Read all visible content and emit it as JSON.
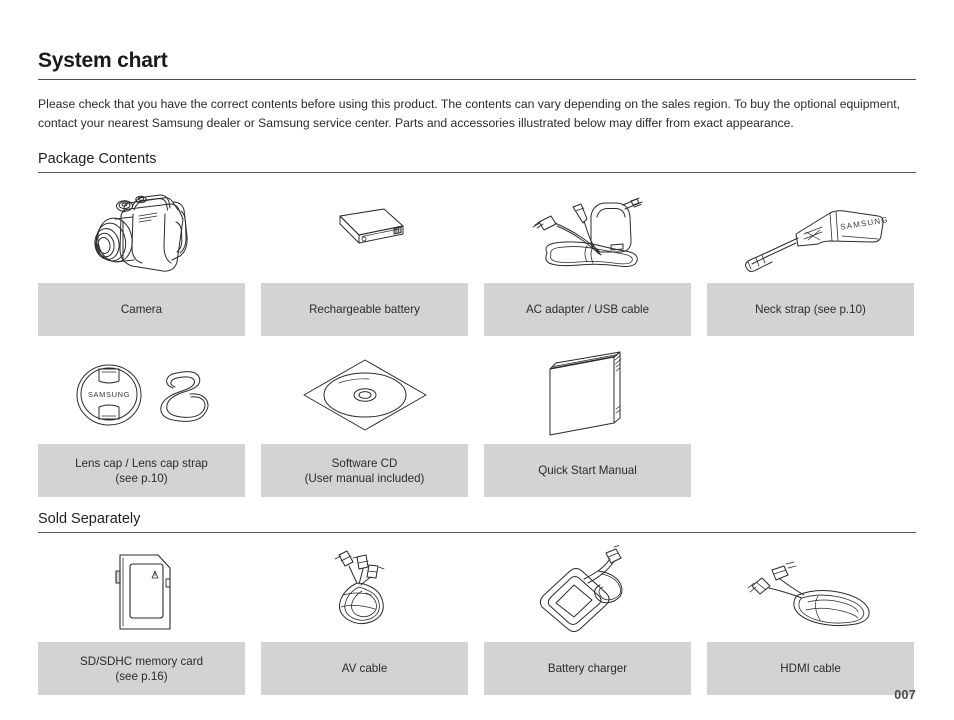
{
  "document": {
    "title": "System chart",
    "intro": "Please check that you have the correct contents before using this product. The contents can vary depending on the sales region. To buy the optional equipment, contact your nearest Samsung dealer or Samsung service center. Parts and accessories illustrated below may differ from exact appearance.",
    "page_number": "007"
  },
  "sections": [
    {
      "heading": "Package Contents",
      "rows": [
        [
          {
            "art": "camera-illustration",
            "line1": "Camera",
            "line2": ""
          },
          {
            "art": "battery-illustration",
            "line1": "Rechargeable battery",
            "line2": ""
          },
          {
            "art": "ac-adapter-usb-cable-illustration",
            "line1": "AC adapter / USB cable",
            "line2": ""
          },
          {
            "art": "neck-strap-illustration",
            "line1": "Neck strap (see p.10)",
            "line2": ""
          }
        ],
        [
          {
            "art": "lens-cap-illustration",
            "line1": "Lens cap / Lens cap strap",
            "line2": "(see p.10)"
          },
          {
            "art": "software-cd-illustration",
            "line1": "Software CD",
            "line2": "(User manual included)"
          },
          {
            "art": "quick-start-manual-illustration",
            "line1": "Quick Start Manual",
            "line2": ""
          }
        ]
      ]
    },
    {
      "heading": "Sold Separately",
      "rows": [
        [
          {
            "art": "sd-card-illustration",
            "line1": "SD/SDHC memory card",
            "line2": "(see p.16)"
          },
          {
            "art": "av-cable-illustration",
            "line1": "AV cable",
            "line2": ""
          },
          {
            "art": "battery-charger-illustration",
            "line1": "Battery charger",
            "line2": ""
          },
          {
            "art": "hdmi-cable-illustration",
            "line1": "HDMI cable",
            "line2": ""
          }
        ]
      ]
    }
  ],
  "branding": {
    "lens_cap_text": "SAMSUNG",
    "neck_strap_text": "SAMSUNG"
  },
  "colors": {
    "caption_background": "#d3d3d4",
    "text": "#2b2b2b",
    "rule": "#555555",
    "page_number": "#4a4a4a"
  }
}
